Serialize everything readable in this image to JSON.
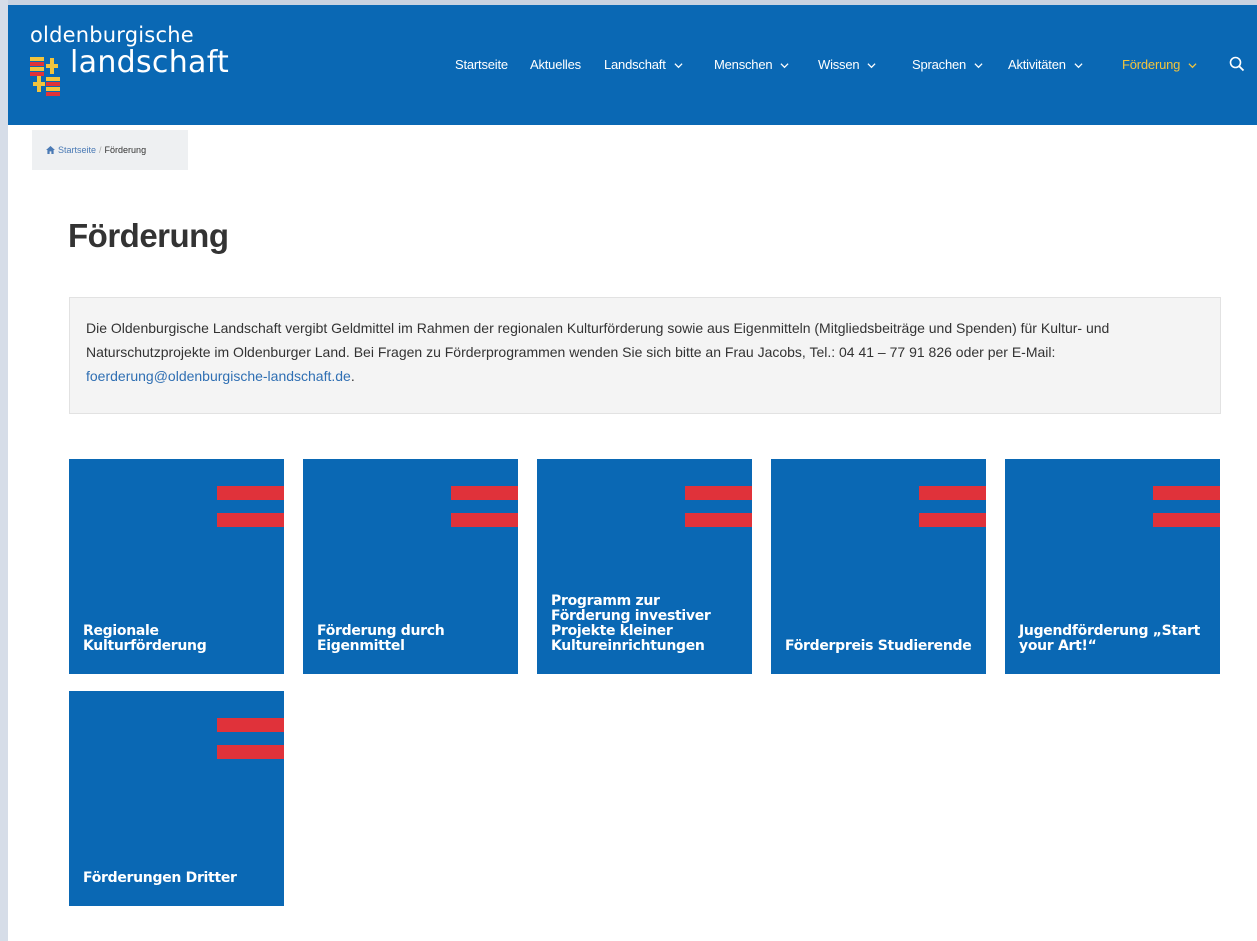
{
  "header": {
    "logo_top": "oldenburgische",
    "logo_main": "landschaft",
    "nav": [
      {
        "label": "Startseite",
        "dropdown": false
      },
      {
        "label": "Aktuelles",
        "dropdown": false
      },
      {
        "label": "Landschaft",
        "dropdown": true
      },
      {
        "label": "Menschen",
        "dropdown": true
      },
      {
        "label": "Wissen",
        "dropdown": true
      },
      {
        "label": "Sprachen",
        "dropdown": true
      },
      {
        "label": "Aktivitäten",
        "dropdown": true
      },
      {
        "label": "Förderung",
        "dropdown": true,
        "active": true
      }
    ],
    "search_icon": "search-icon"
  },
  "breadcrumb": {
    "home_label": "Startseite",
    "separator": "/",
    "current": "Förderung"
  },
  "page": {
    "title": "Förderung",
    "intro_text": "Die Oldenburgische Landschaft vergibt Geldmittel im Rahmen der regionalen Kulturförderung sowie aus Eigenmitteln (Mitgliedsbeiträge und Spenden) für Kultur- und Naturschutzprojekte im Oldenburger Land. Bei Fragen zu Förderprogrammen wenden Sie sich bitte an Frau Jacobs, Tel.: 04 41 – 77 91 826 oder per E-Mail: ",
    "intro_email": "foerderung@oldenburgische-landschaft.de",
    "intro_end": "."
  },
  "tiles": [
    {
      "label": "Regionale Kulturförderung"
    },
    {
      "label": "Förderung durch Eigenmittel"
    },
    {
      "label": "Programm zur Förderung investiver Projekte kleiner Kultureinrichtungen"
    },
    {
      "label": "Förderpreis Studierende"
    },
    {
      "label": "Jugendförderung „Start your Art!“"
    },
    {
      "label": "Förderungen Dritter"
    }
  ],
  "colors": {
    "brand_blue": "#0a68b4",
    "accent_red": "#e0323a",
    "active_nav": "#f2c43d"
  }
}
